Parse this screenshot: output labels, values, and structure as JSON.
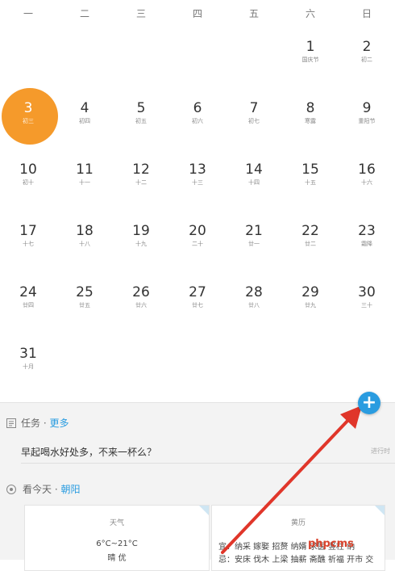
{
  "weekdays": [
    "一",
    "二",
    "三",
    "四",
    "五",
    "六",
    "日"
  ],
  "days": [
    {
      "num": "1",
      "lunar": "国庆节"
    },
    {
      "num": "2",
      "lunar": "初二"
    },
    {
      "num": "3",
      "lunar": "初三"
    },
    {
      "num": "4",
      "lunar": "初四"
    },
    {
      "num": "5",
      "lunar": "初五"
    },
    {
      "num": "6",
      "lunar": "初六"
    },
    {
      "num": "7",
      "lunar": "初七"
    },
    {
      "num": "8",
      "lunar": "寒露"
    },
    {
      "num": "9",
      "lunar": "重阳节"
    },
    {
      "num": "10",
      "lunar": "初十"
    },
    {
      "num": "11",
      "lunar": "十一"
    },
    {
      "num": "12",
      "lunar": "十二"
    },
    {
      "num": "13",
      "lunar": "十三"
    },
    {
      "num": "14",
      "lunar": "十四"
    },
    {
      "num": "15",
      "lunar": "十五"
    },
    {
      "num": "16",
      "lunar": "十六"
    },
    {
      "num": "17",
      "lunar": "十七"
    },
    {
      "num": "18",
      "lunar": "十八"
    },
    {
      "num": "19",
      "lunar": "十九"
    },
    {
      "num": "20",
      "lunar": "二十"
    },
    {
      "num": "21",
      "lunar": "廿一"
    },
    {
      "num": "22",
      "lunar": "廿二"
    },
    {
      "num": "23",
      "lunar": "霜降"
    },
    {
      "num": "24",
      "lunar": "廿四"
    },
    {
      "num": "25",
      "lunar": "廿五"
    },
    {
      "num": "26",
      "lunar": "廿六"
    },
    {
      "num": "27",
      "lunar": "廿七"
    },
    {
      "num": "28",
      "lunar": "廿八"
    },
    {
      "num": "29",
      "lunar": "廿九"
    },
    {
      "num": "30",
      "lunar": "三十"
    },
    {
      "num": "31",
      "lunar": "十月"
    }
  ],
  "first_weekday_index": 5,
  "selected_day": "3",
  "colors": {
    "selected": "#f59a2b",
    "accent": "#2a9ce0",
    "arrow": "#e0362a",
    "watermark": "#d8432d"
  },
  "fab": {
    "label": "+"
  },
  "tasks": {
    "title": "任务",
    "separator": " · ",
    "more": "更多",
    "item": "早起喝水好处多，不来一杯么？",
    "status": "进行时"
  },
  "today": {
    "title": "看今天",
    "separator": " · ",
    "location": "朝阳"
  },
  "weather": {
    "title": "天气",
    "temp": "6°C~21°C",
    "desc": "晴 优"
  },
  "almanac": {
    "title": "黄历",
    "good": "宜：纳采 嫁娶 招赘 纳婿 求医 竖柱 纳",
    "bad": "忌：安床 伐木 上梁 抽薪 斋醮 祈福 开市 交"
  },
  "watermark": "phpcms"
}
